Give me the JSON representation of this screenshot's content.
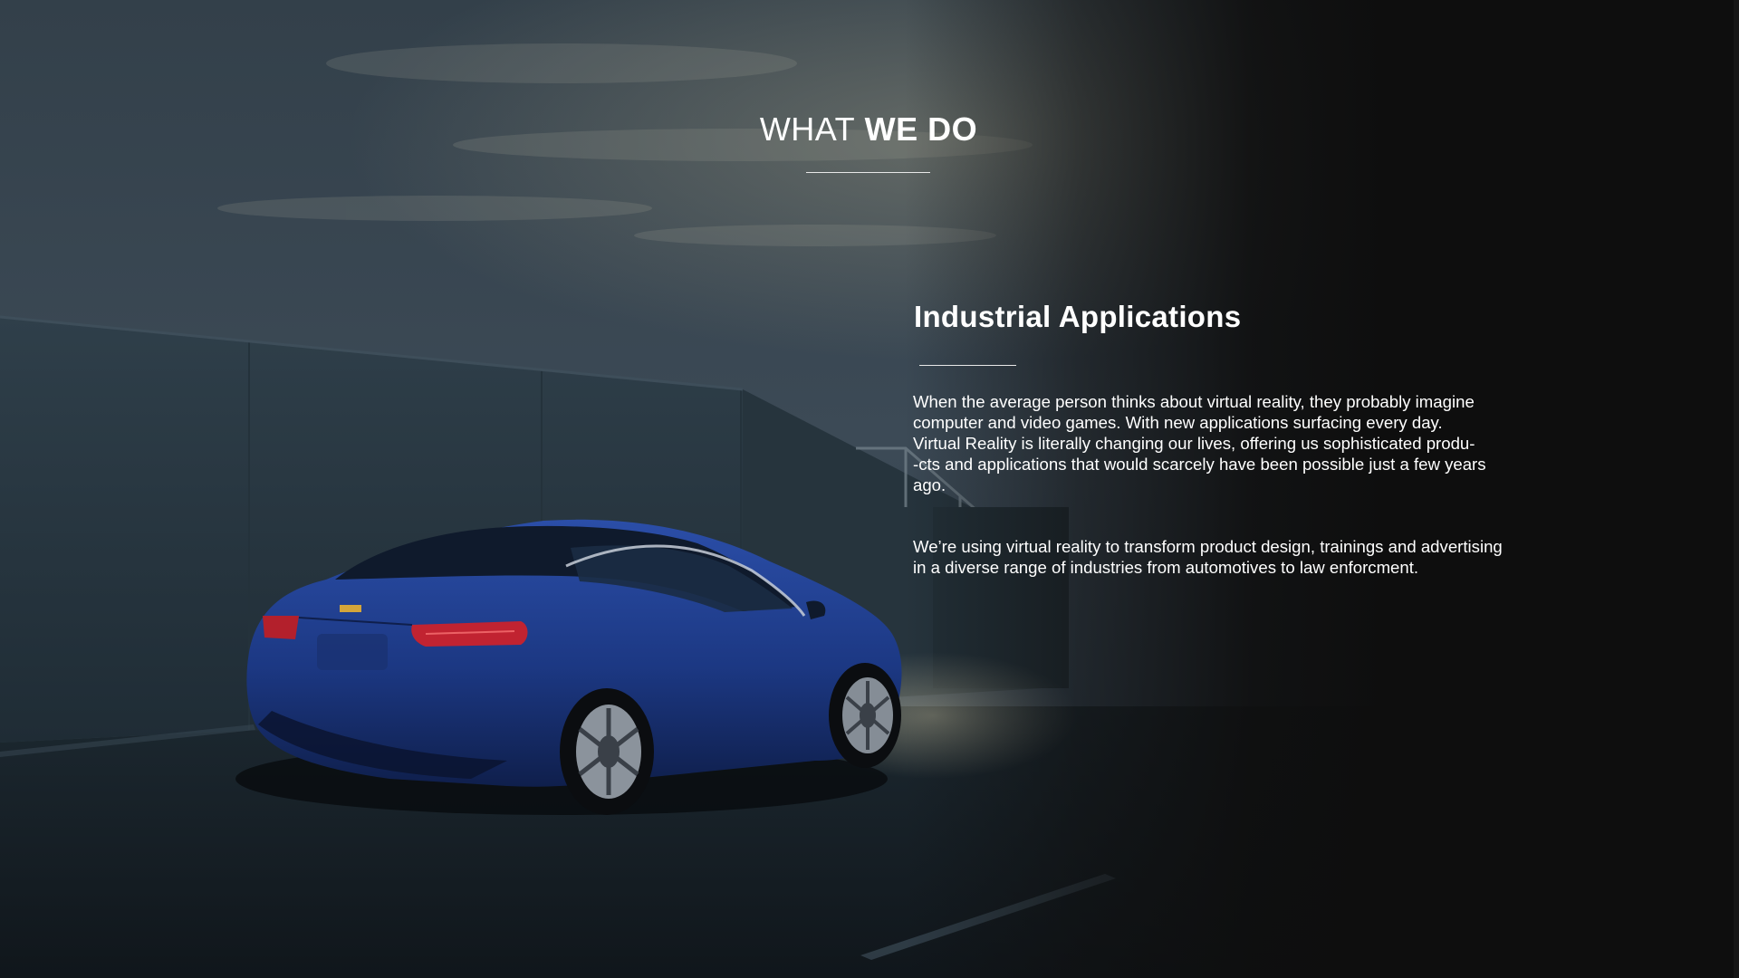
{
  "header": {
    "title_light": "WHAT",
    "title_bold": "WE DO"
  },
  "section": {
    "heading": "Industrial Applications",
    "paragraph_1_lines": [
      "When the average person thinks about virtual reality, they probably imagine",
      "computer and video games. With new applications surfacing every day.",
      "Virtual Reality is literally changing our lives, offering us sophisticated produ-",
      "-cts and applications that would  scarcely have been possible just a few years",
      "ago."
    ],
    "paragraph_2_lines": [
      "We’re using virtual reality to transform product design, trainings and advertising",
      "in a diverse range of industries from automotives to law enforcment."
    ]
  },
  "background": {
    "image_subject": "blue sedan parked on a concrete rooftop at dusk",
    "car_color": "#1e3b86",
    "sky_color": "#2c3c4c",
    "wall_color": "#2a3a44",
    "dark_panel_color": "#0e0e0e"
  }
}
